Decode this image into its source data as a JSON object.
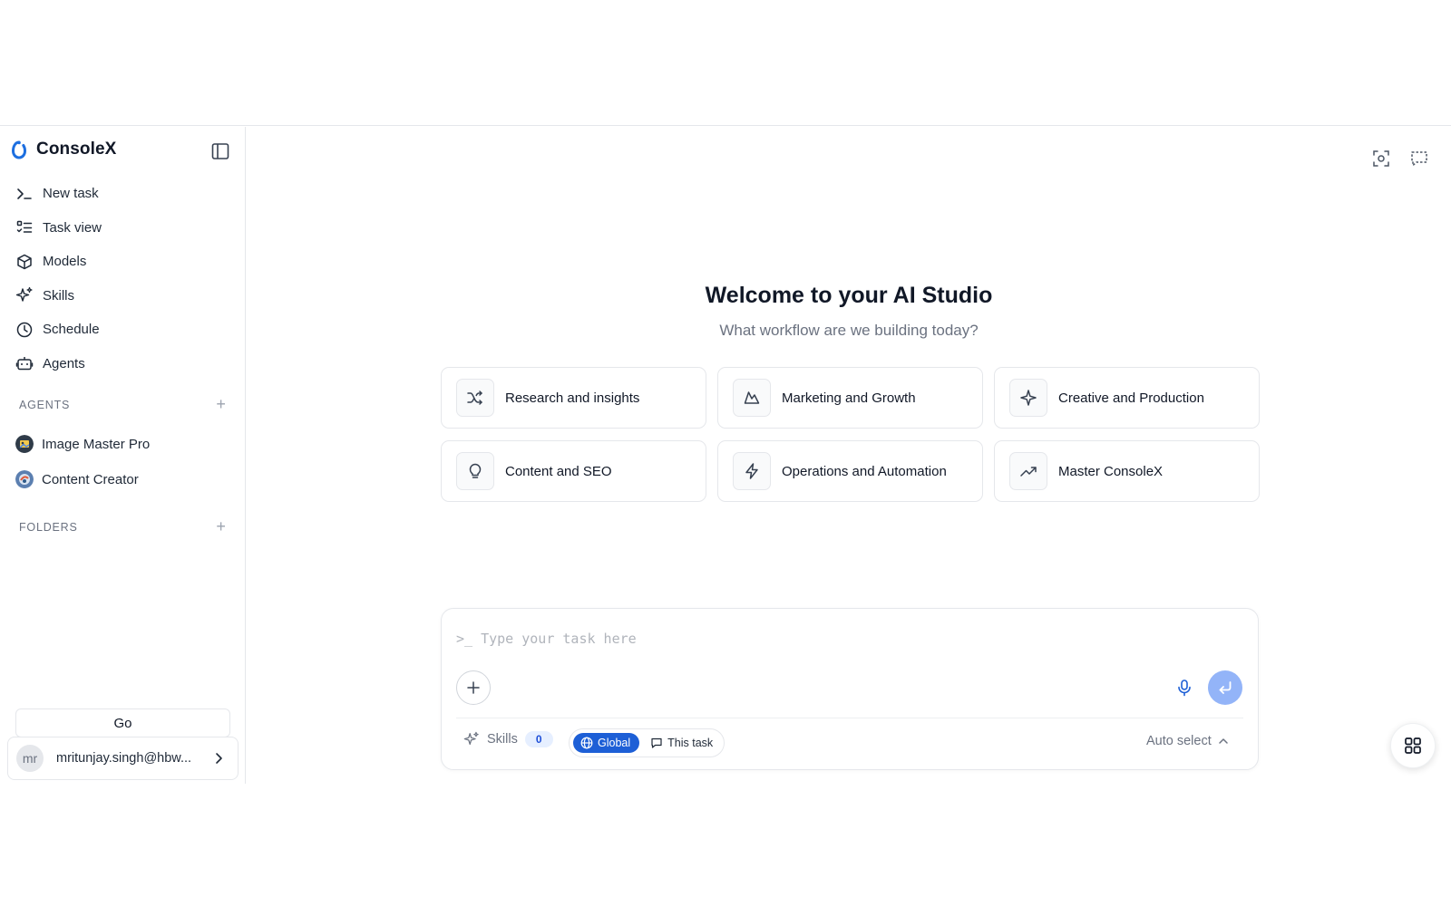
{
  "brand": {
    "name": "ConsoleX"
  },
  "nav": {
    "items": [
      {
        "label": "New task",
        "icon": "terminal-icon"
      },
      {
        "label": "Task view",
        "icon": "list-checks-icon"
      },
      {
        "label": "Models",
        "icon": "cube-icon"
      },
      {
        "label": "Skills",
        "icon": "sparkles-icon"
      },
      {
        "label": "Schedule",
        "icon": "clock-icon"
      },
      {
        "label": "Agents",
        "icon": "bot-icon"
      }
    ]
  },
  "agents_section": {
    "title": "AGENTS",
    "add": "+",
    "items": [
      {
        "label": "Image Master Pro",
        "avatar_color": "#2f3b48"
      },
      {
        "label": "Content Creator",
        "avatar_color": "#5b7fb0"
      }
    ]
  },
  "folders_section": {
    "title": "FOLDERS",
    "add": "+"
  },
  "go_button": {
    "label": "Go"
  },
  "user": {
    "initials": "mr",
    "email": "mritunjay.singh@hbw..."
  },
  "welcome": {
    "title": "Welcome to your AI Studio",
    "subtitle": "What workflow are we building today?"
  },
  "cards": [
    {
      "label": "Research and insights",
      "icon": "shuffle-icon"
    },
    {
      "label": "Marketing and Growth",
      "icon": "mountain-icon"
    },
    {
      "label": "Creative and Production",
      "icon": "sparkle-icon"
    },
    {
      "label": "Content and SEO",
      "icon": "lightbulb-icon"
    },
    {
      "label": "Operations and Automation",
      "icon": "lightning-icon"
    },
    {
      "label": "Master ConsoleX",
      "icon": "trending-up-icon"
    }
  ],
  "composer": {
    "placeholder": ">_ Type your task here",
    "skills_label": "Skills",
    "skills_count": "0",
    "scope_global": "Global",
    "scope_task": "This task",
    "model_select": "Auto select"
  },
  "colors": {
    "accent": "#1d5fd6",
    "send_button": "#93b4f8",
    "border": "#e5e7eb"
  }
}
